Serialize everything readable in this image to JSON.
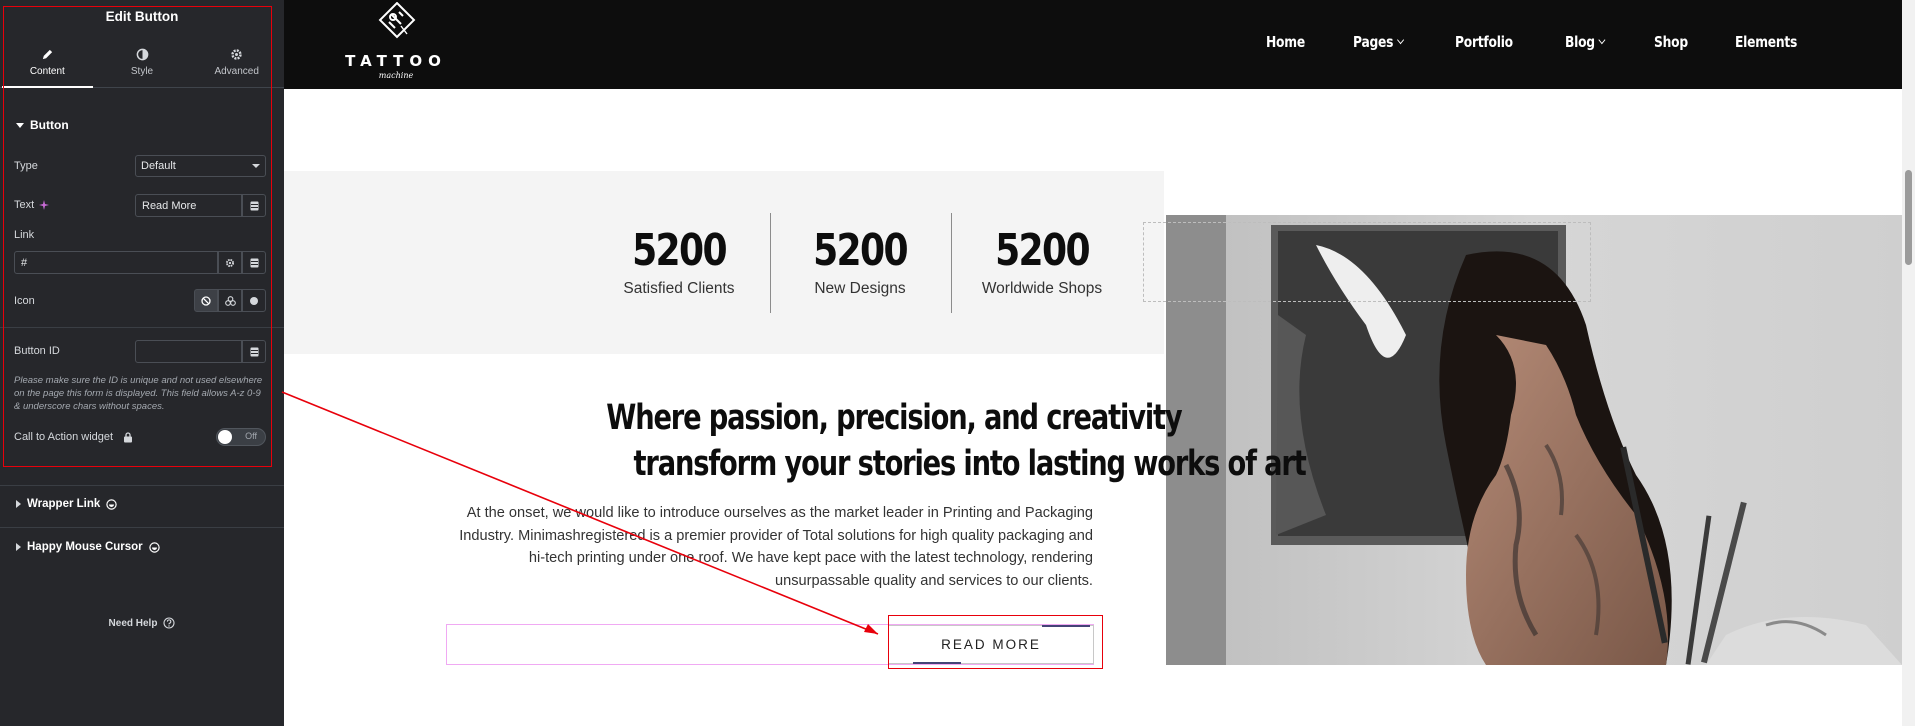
{
  "editor": {
    "title": "Edit Button",
    "tabs": [
      {
        "label": "Content",
        "icon": "pencil-icon"
      },
      {
        "label": "Style",
        "icon": "half-circle-icon"
      },
      {
        "label": "Advanced",
        "icon": "gear-icon"
      }
    ],
    "section_button": "Button",
    "type_label": "Type",
    "type_value": "Default",
    "text_label": "Text",
    "text_value": "Read More",
    "link_label": "Link",
    "link_value": "#",
    "icon_label": "Icon",
    "button_id_label": "Button ID",
    "button_id_value": "",
    "help_text": "Please make sure the ID is unique and not used elsewhere on the page this form is displayed. This field allows A-z  0-9 & underscore chars without spaces.",
    "cta_label": "Call to Action widget",
    "cta_toggle": "Off",
    "section_wrapper_link": "Wrapper Link",
    "section_mouse_cursor": "Happy Mouse Cursor",
    "need_help": "Need Help"
  },
  "site": {
    "logo_word": "TATTOO",
    "logo_script": "machine",
    "nav": [
      {
        "label": "Home",
        "has_dropdown": false
      },
      {
        "label": "Pages",
        "has_dropdown": true
      },
      {
        "label": "Portfolio",
        "has_dropdown": false
      },
      {
        "label": "Blog",
        "has_dropdown": true
      },
      {
        "label": "Shop",
        "has_dropdown": false
      },
      {
        "label": "Elements",
        "has_dropdown": false
      }
    ],
    "stats": [
      {
        "value": "5200",
        "label": "Satisfied Clients"
      },
      {
        "value": "5200",
        "label": "New Designs"
      },
      {
        "value": "5200",
        "label": "Worldwide Shops"
      }
    ],
    "headline_line1": "Where passion, precision, and creativity",
    "headline_line2": "transform your stories into lasting works of art",
    "paragraph": "At the onset, we would like to introduce ourselves as the market leader in Printing and Packaging Industry. Minimashregistered is a premier provider of Total solutions for high quality packaging and hi-tech printing under one roof. We have kept pace with the latest technology, rendering unsurpassable quality and services to our clients.",
    "button_label": "READ MORE"
  },
  "colors": {
    "panel_bg": "#26272b",
    "nav_bg": "#0d0d0d",
    "annotation_red": "#e8000b",
    "outline_pink": "#f0a9f3"
  }
}
